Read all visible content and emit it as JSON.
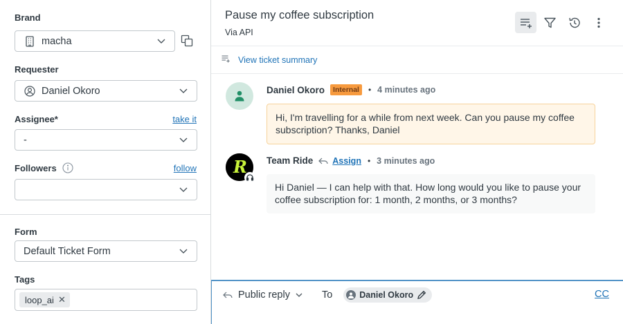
{
  "sidebar": {
    "brand": {
      "label": "Brand",
      "value": "macha"
    },
    "requester": {
      "label": "Requester",
      "value": "Daniel Okoro"
    },
    "assignee": {
      "label": "Assignee*",
      "link": "take it",
      "value": "-"
    },
    "followers": {
      "label": "Followers",
      "link": "follow",
      "value": ""
    },
    "form": {
      "label": "Form",
      "value": "Default Ticket Form"
    },
    "tags": {
      "label": "Tags",
      "items": [
        "loop_ai"
      ]
    }
  },
  "ticket": {
    "title": "Pause my coffee subscription",
    "subtitle": "Via API",
    "summary_link": "View ticket summary"
  },
  "messages": [
    {
      "author": "Daniel Okoro",
      "badge": "Internal",
      "time": "4 minutes ago",
      "body": "Hi, I'm travelling for a while from next week. Can you pause my coffee subscription? Thanks, Daniel"
    },
    {
      "author": "Team Ride",
      "assign": "Assign",
      "time": "3 minutes ago",
      "avatar_letter": "R",
      "body": "Hi Daniel — I can help with that. How long would you like to pause your coffee subscription for: 1 month, 2 months, or 3 months?"
    }
  ],
  "reply": {
    "type": "Public reply",
    "to_label": "To",
    "recipient": "Daniel Okoro",
    "cc": "CC"
  },
  "colors": {
    "link": "#1f73b7",
    "internal_badge": "#f79a3e",
    "internal_bg": "#fff6e8",
    "reply_border": "#5293c7",
    "user_avatar_bg": "#d1e8df",
    "team_avatar_letter": "#c8f23a"
  }
}
